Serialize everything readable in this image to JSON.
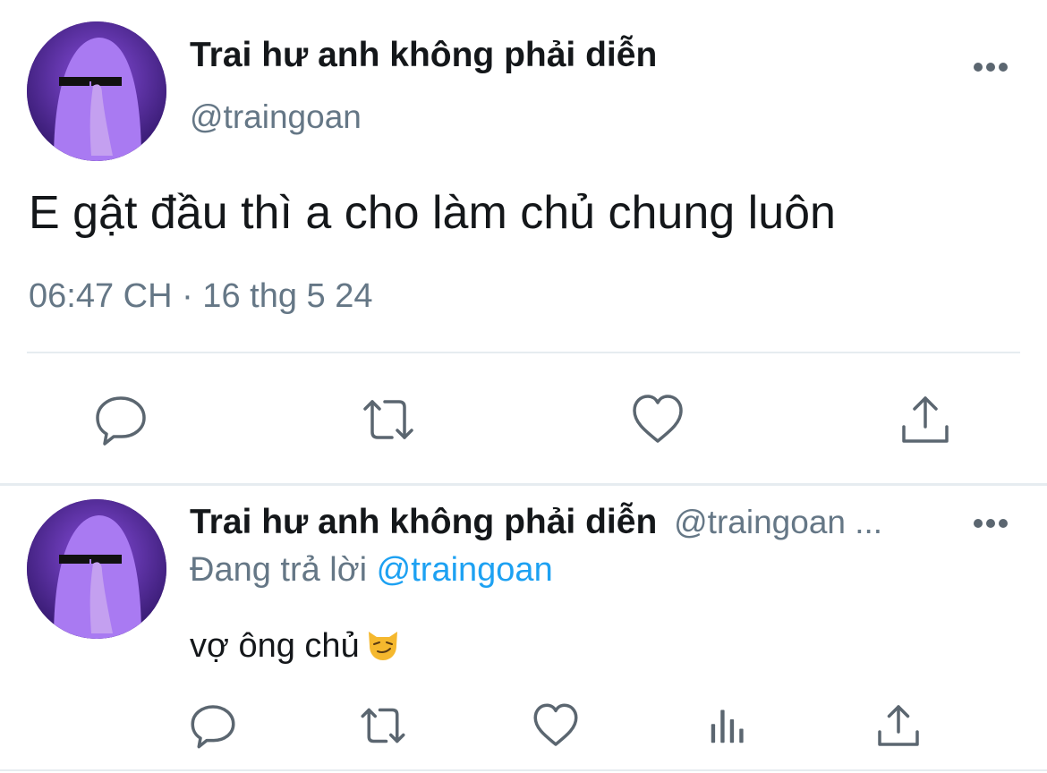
{
  "tweet": {
    "display_name": "Trai hư anh không phải diễn",
    "handle": "@traingoan",
    "text": "E gật đầu thì a cho làm chủ chung luôn",
    "timestamp": "06:47 CH · 16 thg 5 24",
    "actions": [
      "reply-icon",
      "retweet-icon",
      "like-icon",
      "share-icon"
    ]
  },
  "reply": {
    "display_name": "Trai hư anh không phải diễn",
    "handle_truncated": "@traingoan ...",
    "replying_prefix": "Đang trả lời",
    "replying_to": "@traingoan",
    "text": "vợ ông chủ",
    "emoji": "smirking-cat-emoji",
    "actions": [
      "reply-icon",
      "retweet-icon",
      "like-icon",
      "analytics-icon",
      "share-icon"
    ]
  },
  "colors": {
    "text": "#14171a",
    "secondary": "#657786",
    "link": "#1da1f2",
    "divider": "#e6ecf0",
    "icon": "#5b6670"
  }
}
